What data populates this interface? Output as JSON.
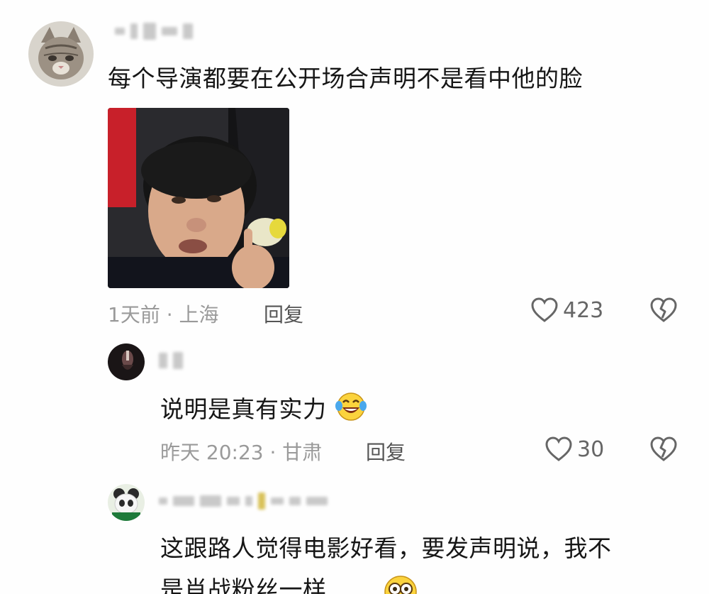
{
  "comments": [
    {
      "text": "每个导演都要在公开场合声明不是看中他的脸",
      "meta": "1天前 · 上海",
      "reply_label": "回复",
      "likes": "423"
    },
    {
      "text": "说明是真有实力",
      "meta": "昨天 20:23 · 甘肃",
      "reply_label": "回复",
      "likes": "30"
    },
    {
      "text_line1": "这跟路人觉得电影好看，要发声明说，我不",
      "text_line2": "是肖战粉丝一样"
    }
  ],
  "icons": {
    "like": "heart-outline-icon",
    "dislike": "broken-heart-icon",
    "emoji_laugh": "laughing-crying-emoji",
    "emoji_wow": "wide-eyed-emoji"
  },
  "colors": {
    "text": "#161616",
    "meta": "#9a9a9a",
    "icon": "#666666"
  }
}
